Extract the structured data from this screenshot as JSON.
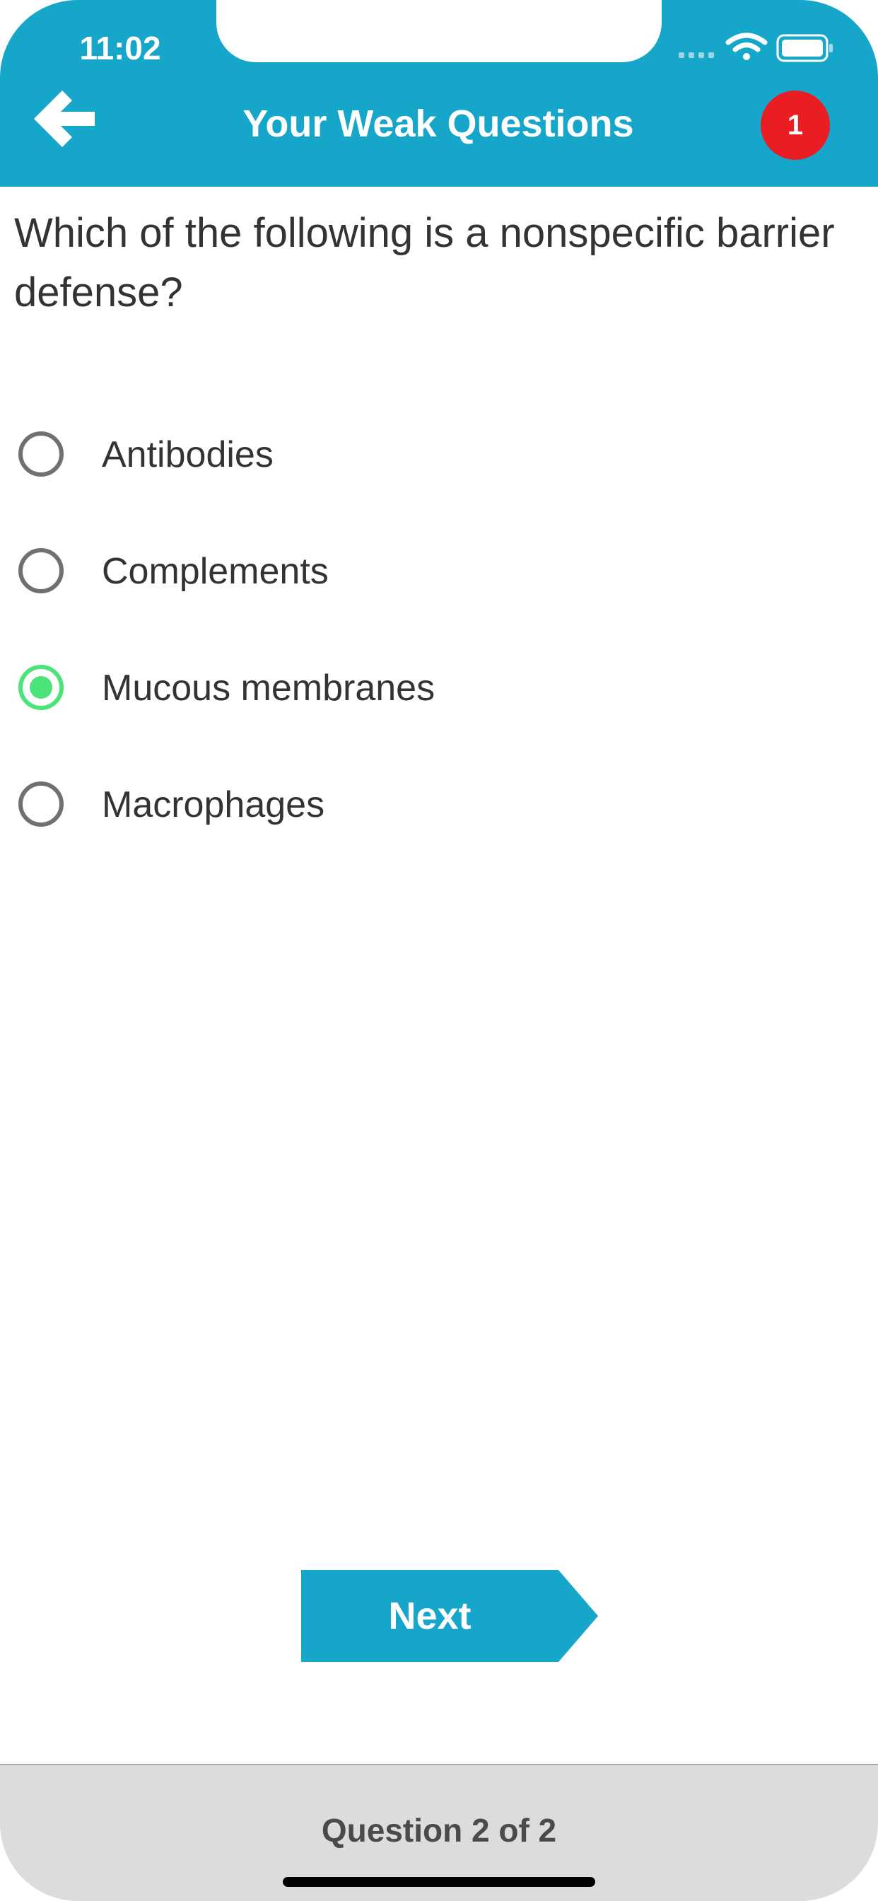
{
  "status_bar": {
    "time": "11:02",
    "icons": [
      "signal-dots-icon",
      "wifi-icon",
      "battery-icon"
    ]
  },
  "header": {
    "title": "Your Weak Questions",
    "back_icon": "arrow-left-icon",
    "badge_count": "1",
    "colors": {
      "background": "#16a6ca",
      "badge": "#ea1c24"
    }
  },
  "question": {
    "text": "Which of the following is a nonspecific barrier defense?"
  },
  "options": [
    {
      "label": "Antibodies",
      "selected": false
    },
    {
      "label": "Complements",
      "selected": false
    },
    {
      "label": "Mucous membranes",
      "selected": true
    },
    {
      "label": "Macrophages",
      "selected": false
    }
  ],
  "next_button": {
    "label": "Next",
    "color": "#16a6ca"
  },
  "footer": {
    "progress_text": "Question 2 of 2"
  },
  "colors": {
    "selected_radio": "#4ce47a",
    "unselected_radio": "#707070"
  }
}
